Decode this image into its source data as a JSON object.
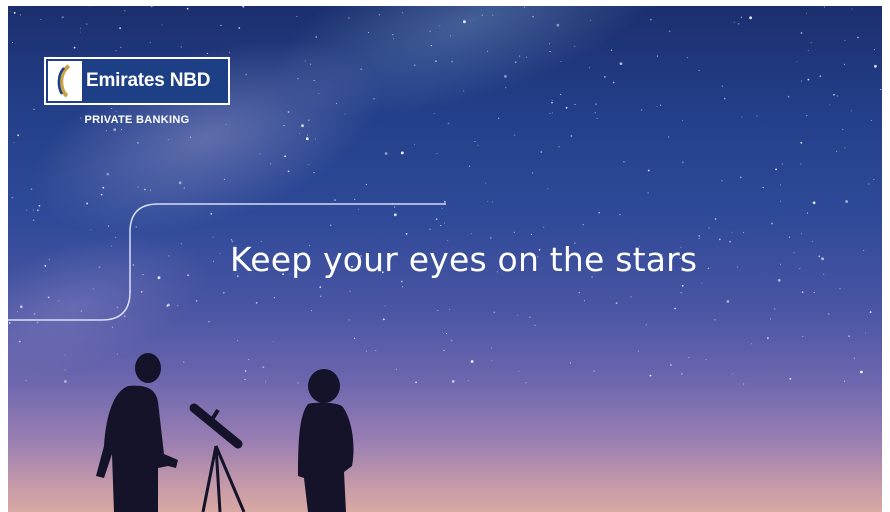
{
  "brand": {
    "name": "Emirates NBD",
    "subtitle": "PRIVATE BANKING",
    "colors": {
      "brand_blue": "#1c3f86",
      "gold": "#c8a24a"
    }
  },
  "hero": {
    "headline": "Keep your eyes on the stars"
  },
  "icons": [
    "emirates-nbd-mark-icon"
  ]
}
